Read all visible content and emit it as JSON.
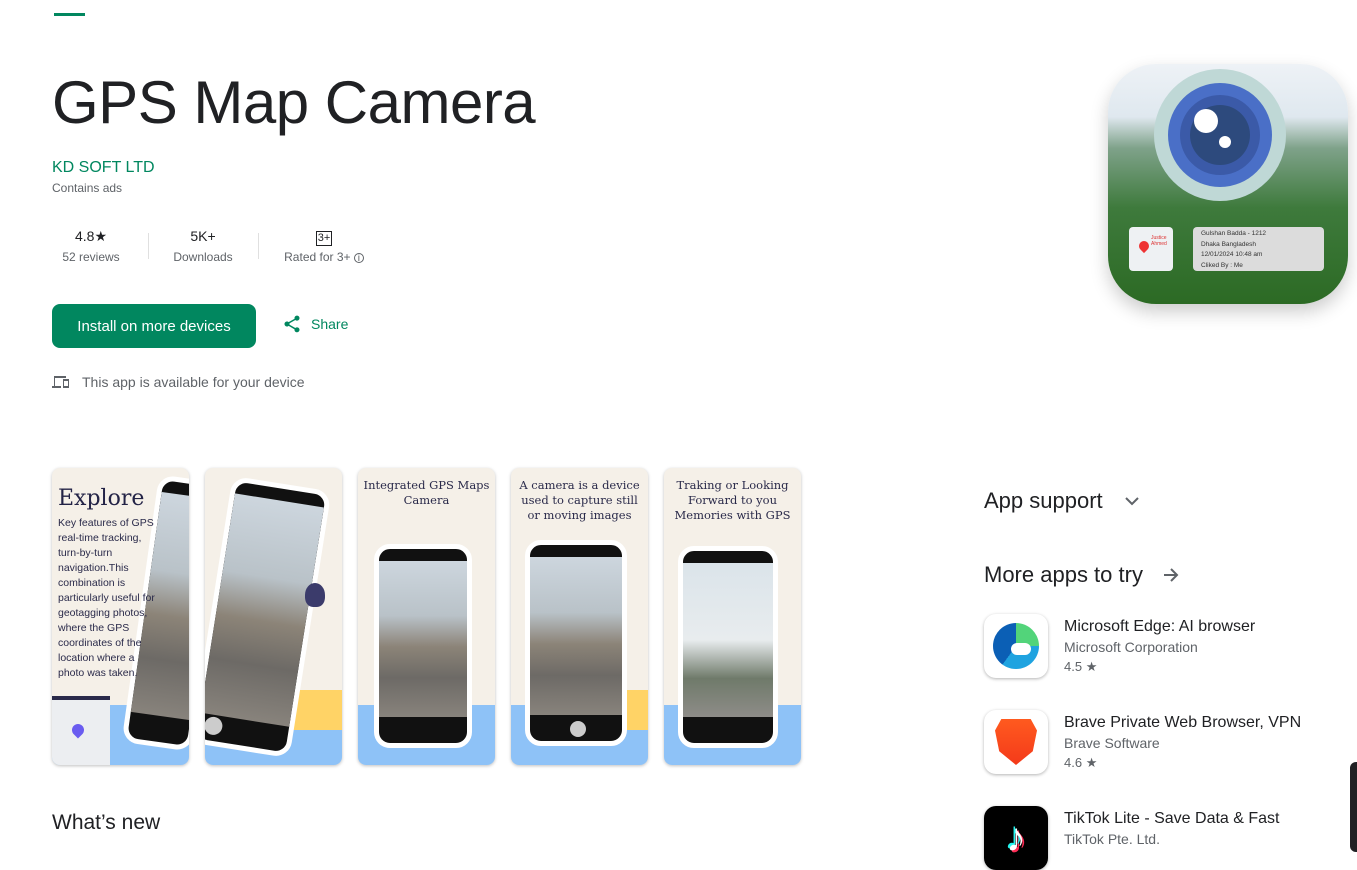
{
  "app": {
    "title": "GPS Map Camera",
    "developer": "KD SOFT LTD",
    "contains_ads": "Contains ads"
  },
  "stats": [
    {
      "value": "4.8★",
      "label": "52 reviews"
    },
    {
      "value": "5K+",
      "label": "Downloads"
    },
    {
      "value": "3+",
      "label": "Rated for 3+"
    }
  ],
  "actions": {
    "install": "Install on more devices",
    "share": "Share",
    "availability": "This app is available for your device"
  },
  "icon_overlay": {
    "lines": [
      "Gulshan Badda - 1212",
      "Dhaka Bangladesh",
      "12/01/2024 10:48 am",
      "Cliked By : Me"
    ],
    "map_label": "Justice Ahmed"
  },
  "screenshots": [
    {
      "heading": "Explore",
      "caption": "Key features of GPS real-time tracking, turn-by-turn navigation.This combination is particularly useful for geotagging photos, where the GPS coordinates of the location where a photo was taken."
    },
    {
      "caption": ""
    },
    {
      "caption": "Integrated GPS Maps Camera"
    },
    {
      "caption": "A camera is a device used to capture still or moving images"
    },
    {
      "caption": "Traking or Looking Forward to you Memories with GPS"
    }
  ],
  "sections": {
    "whats_new": "What’s new",
    "app_support": "App support",
    "more_apps": "More apps to try"
  },
  "more_apps": [
    {
      "name": "Microsoft Edge: AI browser",
      "developer": "Microsoft Corporation",
      "rating": "4.5",
      "icon": "edge-icon"
    },
    {
      "name": "Brave Private Web Browser, VPN",
      "developer": "Brave Software",
      "rating": "4.6",
      "icon": "brave-icon"
    },
    {
      "name": "TikTok Lite - Save Data & Fast",
      "developer": "TikTok Pte. Ltd.",
      "icon": "tiktok-icon"
    }
  ],
  "colors": {
    "accent": "#01875f"
  }
}
